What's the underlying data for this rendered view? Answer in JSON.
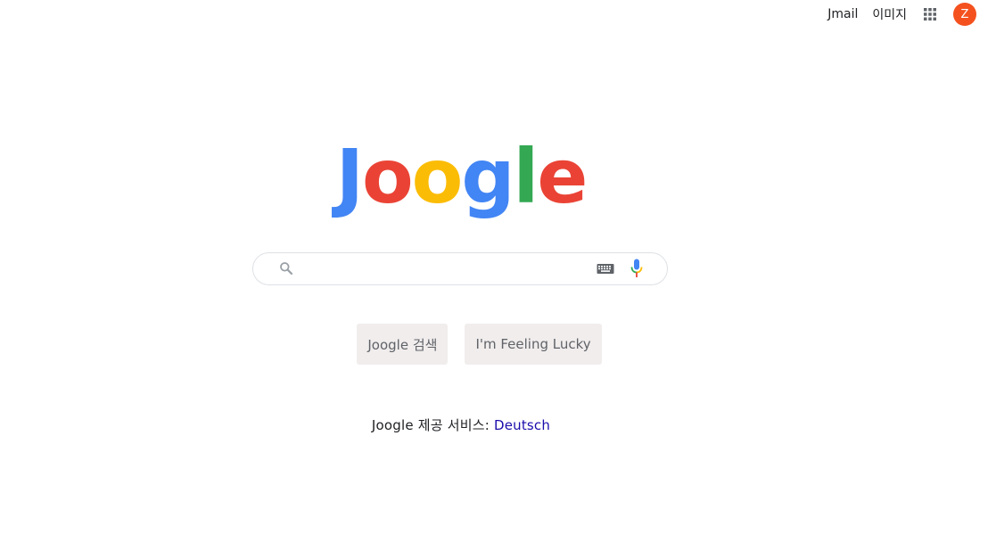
{
  "header": {
    "links": [
      "Jmail",
      "이미지"
    ],
    "apps_icon": "apps-grid-icon",
    "avatar_initial": "Z",
    "avatar_color": "#f4511e"
  },
  "logo": {
    "letters": [
      {
        "char": "J",
        "color": "#4285f4"
      },
      {
        "char": "o",
        "color": "#ea4335"
      },
      {
        "char": "o",
        "color": "#fbbc05"
      },
      {
        "char": "g",
        "color": "#4285f4"
      },
      {
        "char": "l",
        "color": "#34a853"
      },
      {
        "char": "e",
        "color": "#ea4335"
      }
    ]
  },
  "search": {
    "value": "",
    "placeholder": "",
    "icons": [
      "search-icon",
      "keyboard-icon",
      "microphone-icon"
    ]
  },
  "buttons": {
    "search_label": "Joogle 검색",
    "lucky_label": "I'm Feeling Lucky"
  },
  "offered": {
    "prefix": "Joogle 제공 서비스: ",
    "language": "Deutsch"
  }
}
